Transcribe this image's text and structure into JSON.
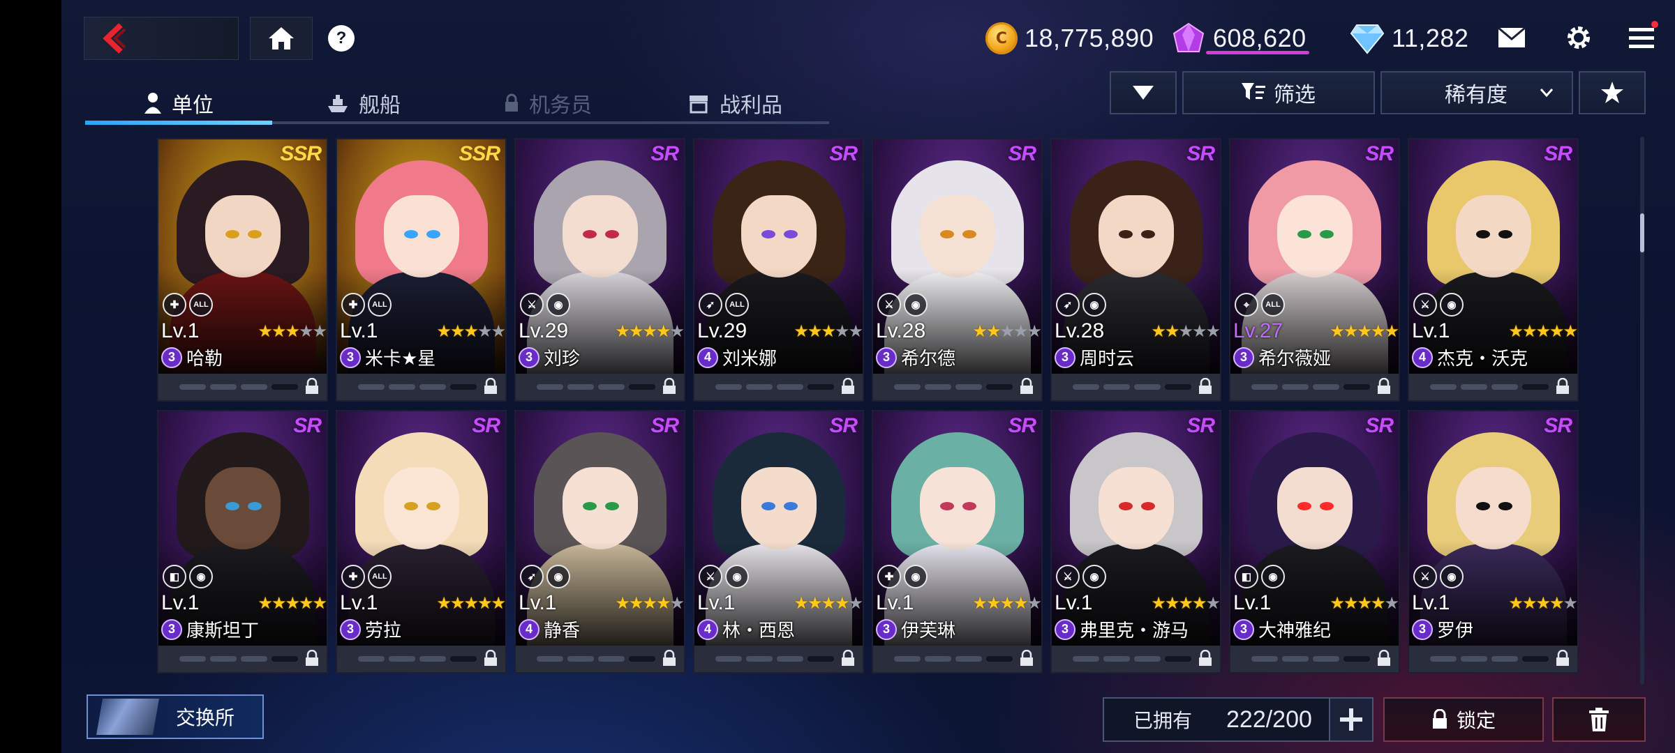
{
  "currencies": {
    "gold": "18,775,890",
    "crystal": "608,620",
    "diamond": "11,282"
  },
  "tabs": [
    {
      "label": "单位",
      "active": true,
      "disabled": false
    },
    {
      "label": "舰船",
      "active": false,
      "disabled": false
    },
    {
      "label": "机务员",
      "active": false,
      "disabled": true
    },
    {
      "label": "战利品",
      "active": false,
      "disabled": false
    }
  ],
  "controls": {
    "filter_label": "筛选",
    "sort_label": "稀有度"
  },
  "units": [
    {
      "name": "哈勒",
      "level": "Lv.1",
      "rarity": "SSR",
      "stars": 3,
      "badge": "3",
      "classes": [
        "ally",
        "ALL"
      ],
      "level_highlight": false
    },
    {
      "name": "米卡★星",
      "level": "Lv.1",
      "rarity": "SSR",
      "stars": 3,
      "badge": "3",
      "classes": [
        "ally",
        "ALL"
      ],
      "level_highlight": false
    },
    {
      "name": "刘珍",
      "level": "Lv.29",
      "rarity": "SR",
      "stars": 4,
      "badge": "3",
      "classes": [
        "sword",
        "ground"
      ],
      "level_highlight": false
    },
    {
      "name": "刘米娜",
      "level": "Lv.29",
      "rarity": "SR",
      "stars": 3,
      "badge": "4",
      "classes": [
        "gun",
        "ALL"
      ],
      "level_highlight": false
    },
    {
      "name": "希尔德",
      "level": "Lv.28",
      "rarity": "SR",
      "stars": 2,
      "badge": "3",
      "classes": [
        "sword",
        "ground"
      ],
      "level_highlight": false
    },
    {
      "name": "周时云",
      "level": "Lv.28",
      "rarity": "SR",
      "stars": 2,
      "badge": "3",
      "classes": [
        "gun",
        "ground"
      ],
      "level_highlight": false
    },
    {
      "name": "希尔薇娅",
      "level": "Lv.27",
      "rarity": "SR",
      "stars": 5,
      "badge": "3",
      "classes": [
        "target",
        "ALL"
      ],
      "level_highlight": true
    },
    {
      "name": "杰克・沃克",
      "level": "Lv.1",
      "rarity": "SR",
      "stars": 5,
      "badge": "4",
      "classes": [
        "sword",
        "ground"
      ],
      "level_highlight": false
    },
    {
      "name": "康斯坦丁",
      "level": "Lv.1",
      "rarity": "SR",
      "stars": 5,
      "badge": "3",
      "classes": [
        "shield",
        "ground"
      ],
      "level_highlight": false
    },
    {
      "name": "劳拉",
      "level": "Lv.1",
      "rarity": "SR",
      "stars": 5,
      "badge": "3",
      "classes": [
        "ally",
        "ALL"
      ],
      "level_highlight": false
    },
    {
      "name": "静香",
      "level": "Lv.1",
      "rarity": "SR",
      "stars": 4,
      "badge": "4",
      "classes": [
        "gun",
        "ground"
      ],
      "level_highlight": false
    },
    {
      "name": "林・西恩",
      "level": "Lv.1",
      "rarity": "SR",
      "stars": 4,
      "badge": "4",
      "classes": [
        "sword",
        "ground"
      ],
      "level_highlight": false
    },
    {
      "name": "伊芙琳",
      "level": "Lv.1",
      "rarity": "SR",
      "stars": 4,
      "badge": "3",
      "classes": [
        "ally",
        "ground"
      ],
      "level_highlight": false
    },
    {
      "name": "弗里克・游马",
      "level": "Lv.1",
      "rarity": "SR",
      "stars": 4,
      "badge": "3",
      "classes": [
        "sword",
        "ground"
      ],
      "level_highlight": false
    },
    {
      "name": "大神雅纪",
      "level": "Lv.1",
      "rarity": "SR",
      "stars": 4,
      "badge": "3",
      "classes": [
        "shield",
        "ground"
      ],
      "level_highlight": false
    },
    {
      "name": "罗伊",
      "level": "Lv.1",
      "rarity": "SR",
      "stars": 4,
      "badge": "3",
      "classes": [
        "sword",
        "ground"
      ],
      "level_highlight": false
    }
  ],
  "bottom": {
    "exchange_label": "交换所",
    "owned_label": "已拥有",
    "owned_count": "222/200",
    "lock_label": "锁定"
  },
  "colors": {
    "accent_blue": "#2aa4ff",
    "ssr_gold": "#ffd84a",
    "sr_purple": "#c64dff",
    "star_gold": "#ffc81e",
    "badge_purple": "#6a2cc8"
  }
}
